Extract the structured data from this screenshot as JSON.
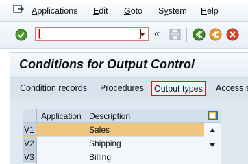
{
  "menu": {
    "items": [
      {
        "label": "Applications",
        "accel": "A"
      },
      {
        "label": "Edit",
        "accel": "E"
      },
      {
        "label": "Goto",
        "accel": "G"
      },
      {
        "label": "System",
        "accel": "y"
      },
      {
        "label": "Help",
        "accel": "H"
      }
    ]
  },
  "toolbar": {
    "command_field": {
      "value": "",
      "placeholder": ""
    },
    "back_label": "«",
    "icons": [
      "enter-icon",
      "back-double-arrow-icon",
      "save-icon",
      "back-icon",
      "exit-icon",
      "cancel-icon"
    ]
  },
  "page": {
    "title": "Conditions for Output Control"
  },
  "app_toolbar": {
    "buttons": [
      {
        "label": "Condition records"
      },
      {
        "label": "Procedures"
      },
      {
        "label": "Output types",
        "highlighted": true
      },
      {
        "label": "Access s"
      }
    ]
  },
  "table": {
    "columns": [
      "Application",
      "Description"
    ],
    "rows": [
      {
        "application": "V1",
        "description": "Sales",
        "selected": true
      },
      {
        "application": "V2",
        "description": "Shipping",
        "selected": false
      },
      {
        "application": "V3",
        "description": "Billing",
        "selected": false
      }
    ]
  },
  "colors": {
    "highlight_border": "#d11a1a",
    "selected_row": "#efc580",
    "content_bg": "#dfe8f1"
  }
}
